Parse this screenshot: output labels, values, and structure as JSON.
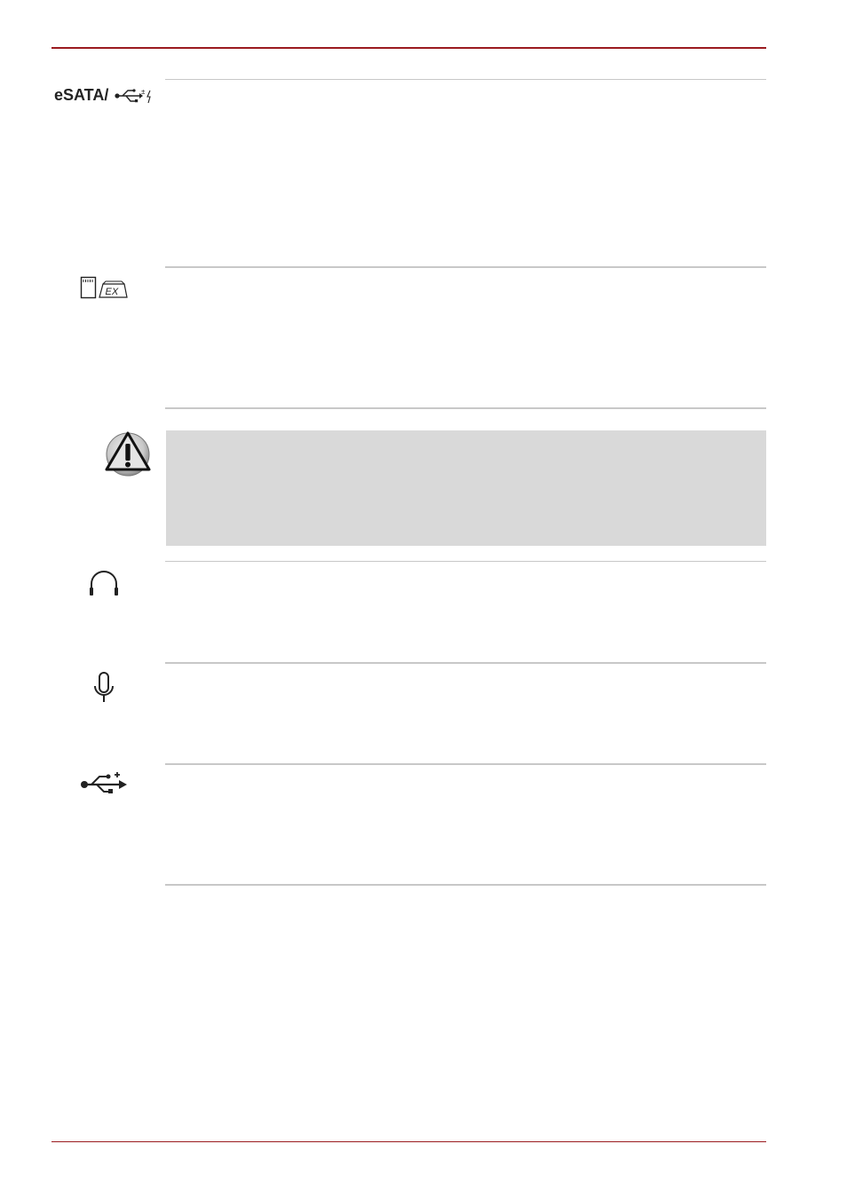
{
  "header": {
    "rule_color": "#9b1b1f"
  },
  "footer": {
    "rule_color": "#9b1b1f"
  },
  "rows": [
    {
      "id": "esata-usb",
      "icon": "esata-usb-sleep-charge-icon",
      "label": "eSATA/"
    },
    {
      "id": "bridge-media",
      "icon": "bridge-media-slot-icon",
      "icon_text": "EX"
    },
    {
      "id": "caution",
      "icon": "caution-warning-icon"
    },
    {
      "id": "headphone",
      "icon": "headphone-jack-icon"
    },
    {
      "id": "microphone",
      "icon": "microphone-jack-icon"
    },
    {
      "id": "usb",
      "icon": "usb-port-icon"
    }
  ],
  "colors": {
    "caution_fill": "#d9d9d9",
    "divider": "#c8c8c8"
  }
}
